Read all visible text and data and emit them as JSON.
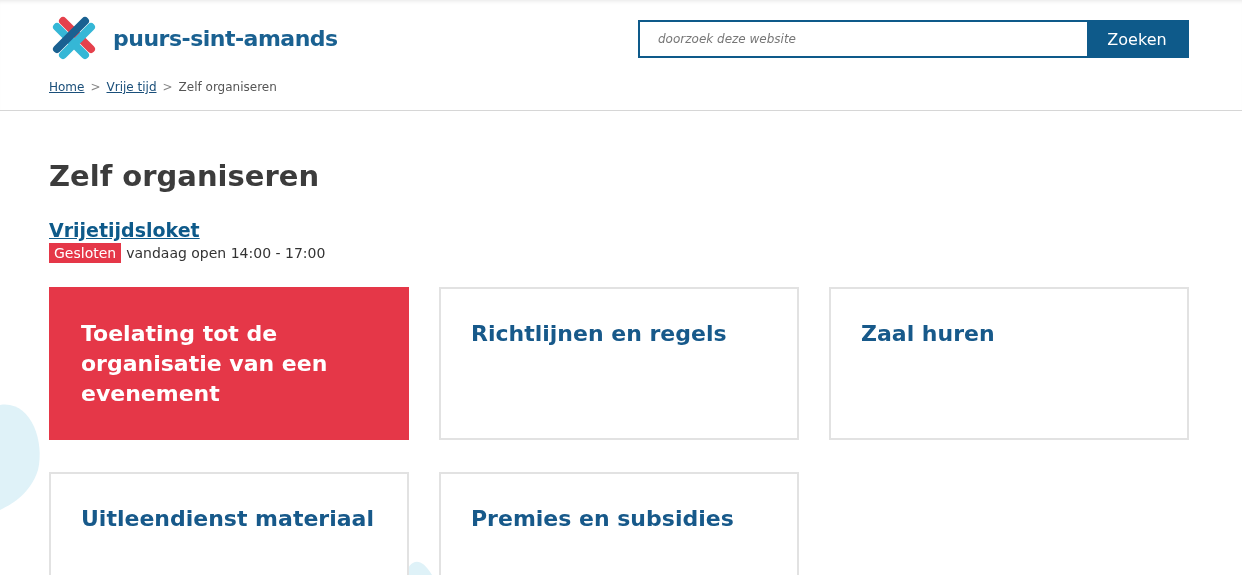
{
  "header": {
    "logo_text": "puurs-sint-amands",
    "search": {
      "placeholder": "doorzoek deze website",
      "button": "Zoeken"
    }
  },
  "breadcrumb": [
    {
      "label": "Home",
      "link": true
    },
    {
      "label": "Vrije tijd",
      "link": true
    },
    {
      "label": "Zelf organiseren",
      "link": false
    }
  ],
  "breadcrumb_separator": ">",
  "page_title": "Zelf organiseren",
  "desk": {
    "name": "Vrijetijdsloket",
    "status": "Gesloten",
    "hours": "vandaag open 14:00 - 17:00"
  },
  "tiles": [
    {
      "label": "Toelating tot de organisatie van een evenement",
      "selected": true
    },
    {
      "label": "Richtlijnen en regels",
      "selected": false
    },
    {
      "label": "Zaal huren",
      "selected": false
    },
    {
      "label": "Uitleendienst materiaal",
      "selected": false
    },
    {
      "label": "Premies en subsidies",
      "selected": false
    }
  ]
}
